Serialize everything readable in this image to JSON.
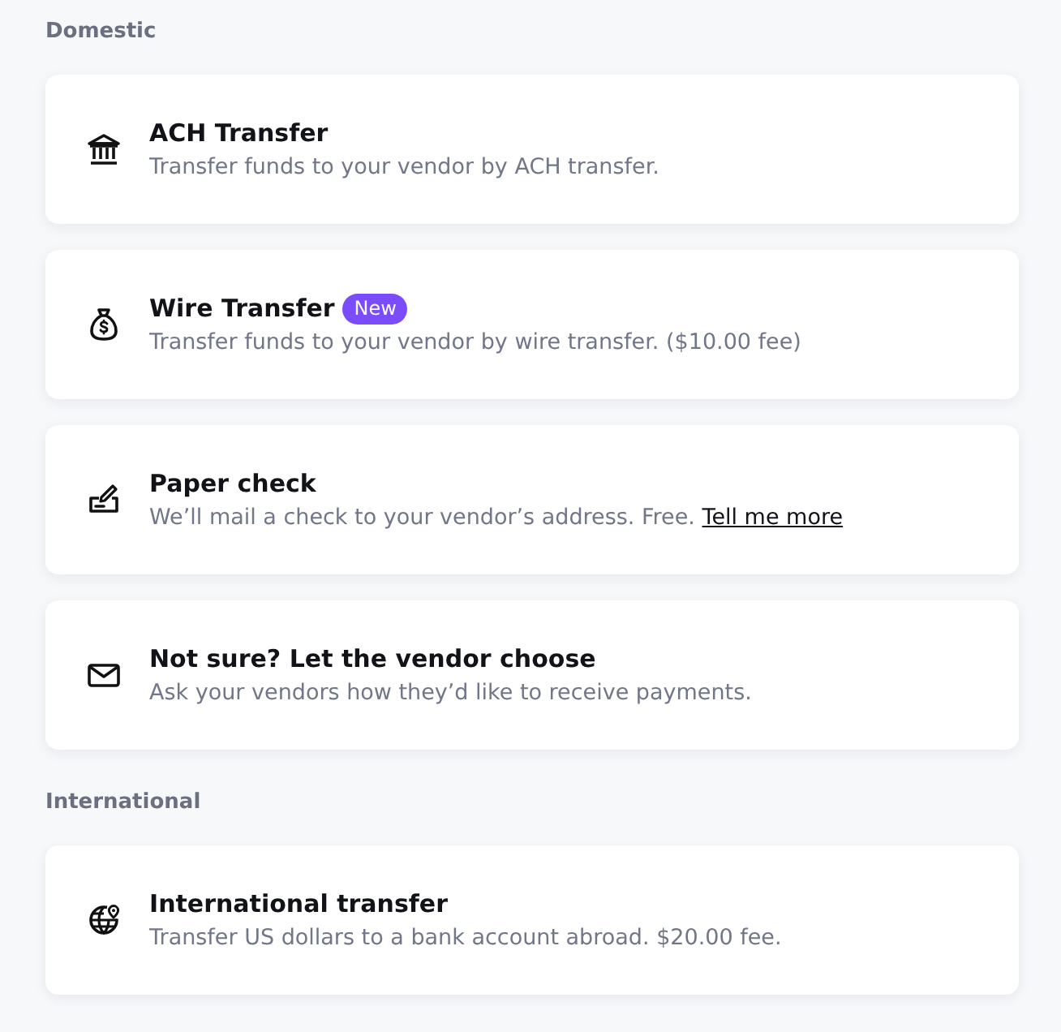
{
  "sections": [
    {
      "heading": "Domestic",
      "methods": [
        {
          "kind": "ach",
          "title": "ACH Transfer",
          "description": "Transfer funds to your vendor by ACH transfer."
        },
        {
          "kind": "wire",
          "title": "Wire Transfer",
          "badge": "New",
          "description": "Transfer funds to your vendor by wire transfer. ($10.00 fee)"
        },
        {
          "kind": "check",
          "title": "Paper check",
          "description": "We’ll mail a check to your vendor’s address. Free.",
          "link": "Tell me more"
        },
        {
          "kind": "vendor-choice",
          "title": "Not sure? Let the vendor choose",
          "description": "Ask your vendors how they’d like to receive payments."
        }
      ]
    },
    {
      "heading": "International",
      "methods": [
        {
          "kind": "international",
          "title": "International transfer",
          "description": "Transfer US dollars to a bank account abroad. $20.00 fee."
        }
      ]
    }
  ]
}
